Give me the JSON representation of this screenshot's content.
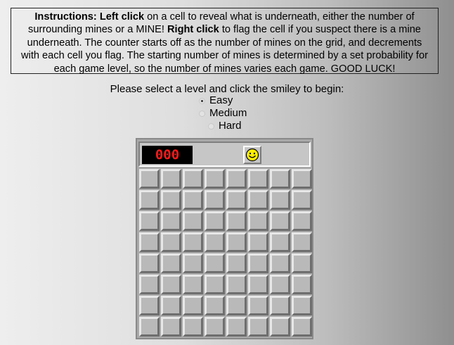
{
  "instructions": {
    "lead_bold": "Instructions:",
    "left_click_bold": "Left click",
    "text_1": " on a cell to reveal what is underneath, either the number of surrounding mines or a MINE! ",
    "right_click_bold": "Right click",
    "text_2": " to flag the cell if you suspect there is a mine underneath. The counter starts off as the number of mines on the grid, and decrements with each cell you flag. The starting number of mines is determined by a set probability for each game level, so the number of mines varies each game. GOOD LUCK!"
  },
  "prompt": "Please select a level and click the smiley to begin:",
  "levels": [
    {
      "label": "Easy",
      "selected": true
    },
    {
      "label": "Medium",
      "selected": false
    },
    {
      "label": "Hard",
      "selected": false
    }
  ],
  "game": {
    "mine_counter": "000",
    "smiley_icon": "smiley-face-icon",
    "rows": 8,
    "columns": 8
  },
  "colors": {
    "counter_digits": "#ff1a1a",
    "smiley_face": "#ffee00"
  }
}
